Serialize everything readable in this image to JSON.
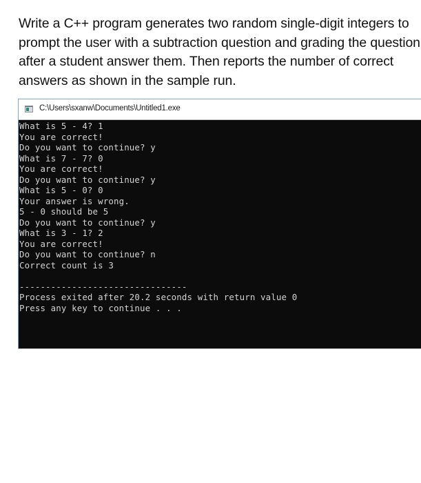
{
  "question": {
    "lines": [
      "Write a C++ program generates two random single-digit integers to",
      "prompt the user with a subtraction question and grading the question",
      "after a student answer them. Then reports the number of correct",
      "answers as shown in the sample run."
    ]
  },
  "console_window": {
    "title": "C:\\Users\\sxanw\\Documents\\Untitled1.exe",
    "icon": "console-app-icon",
    "output_lines": [
      "What is 5 - 4? 1",
      "You are correct!",
      "Do you want to continue? y",
      "What is 7 - 7? 0",
      "You are correct!",
      "Do you want to continue? y",
      "What is 5 - 0? 0",
      "Your answer is wrong.",
      "5 - 0 should be 5",
      "Do you want to continue? y",
      "What is 3 - 1? 2",
      "You are correct!",
      "Do you want to continue? n",
      "Correct count is 3",
      "",
      "--------------------------------",
      "Process exited after 20.2 seconds with return value 0",
      "Press any key to continue . . ."
    ]
  }
}
